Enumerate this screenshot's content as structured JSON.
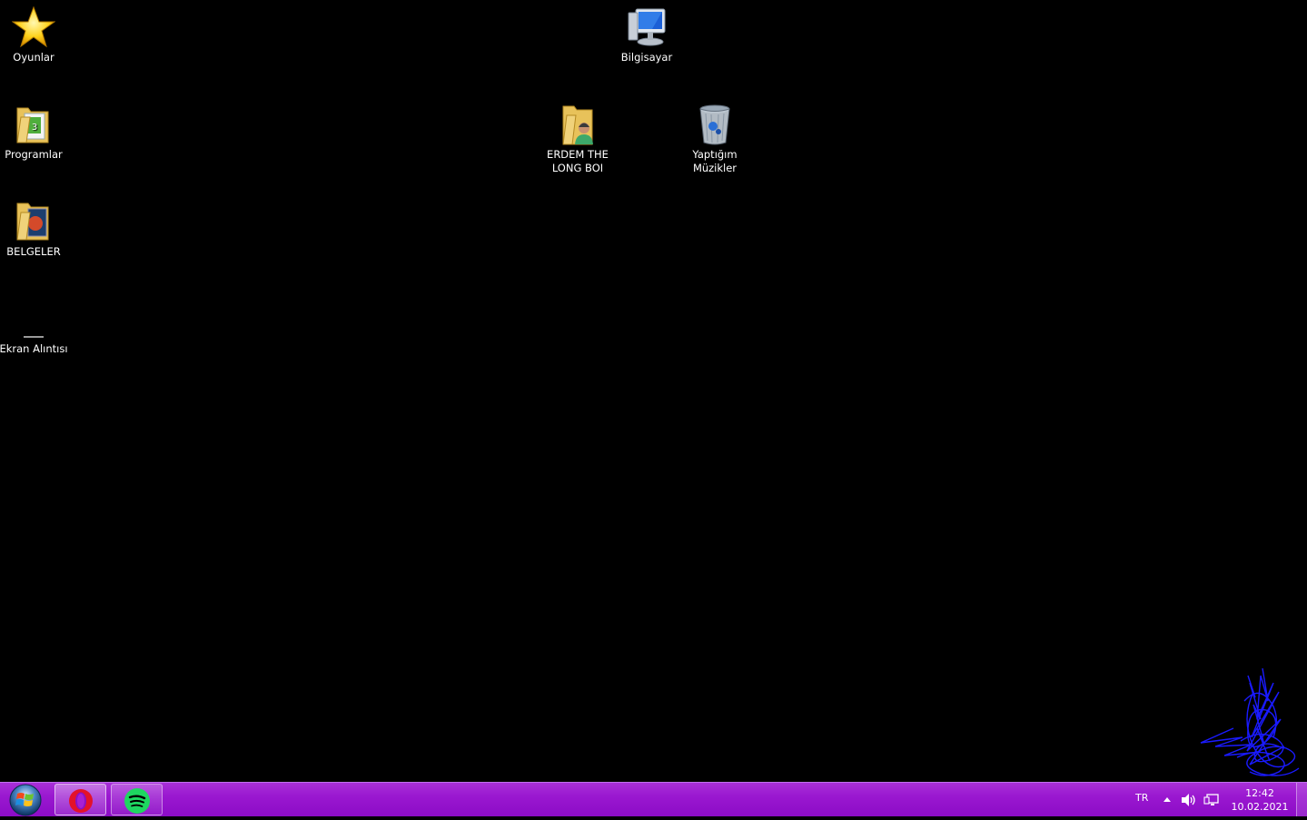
{
  "desktop": {
    "icons": [
      {
        "label": "Oyunlar",
        "icon": "star-icon"
      },
      {
        "label": "Bilgisayar",
        "icon": "computer-icon"
      },
      {
        "label": "Programlar",
        "icon": "folder-icon"
      },
      {
        "label": "ERDEM THE LONG BOI",
        "icon": "user-folder-icon"
      },
      {
        "label": "Yaptığım Müzikler",
        "icon": "recycle-bin-icon"
      },
      {
        "label": "BELGELER",
        "icon": "folder-icon"
      },
      {
        "label": "Ekran Alıntısı",
        "icon": "snipping-tool-icon"
      }
    ]
  },
  "taskbar": {
    "start": {
      "icon": "windows-logo-icon"
    },
    "apps": [
      {
        "name": "Opera",
        "icon": "opera-icon",
        "state": "active"
      },
      {
        "name": "Spotify",
        "icon": "spotify-icon",
        "state": "pinned"
      }
    ],
    "tray": {
      "language": "TR",
      "icons": [
        "show-hidden-icons-icon",
        "volume-icon",
        "network-icon"
      ]
    },
    "clock": {
      "time": "12:42",
      "date": "10.02.2021"
    }
  },
  "colors": {
    "desktop_background": "#000000",
    "taskbar": "#9a18d0",
    "scribble": "#1a1aff"
  }
}
